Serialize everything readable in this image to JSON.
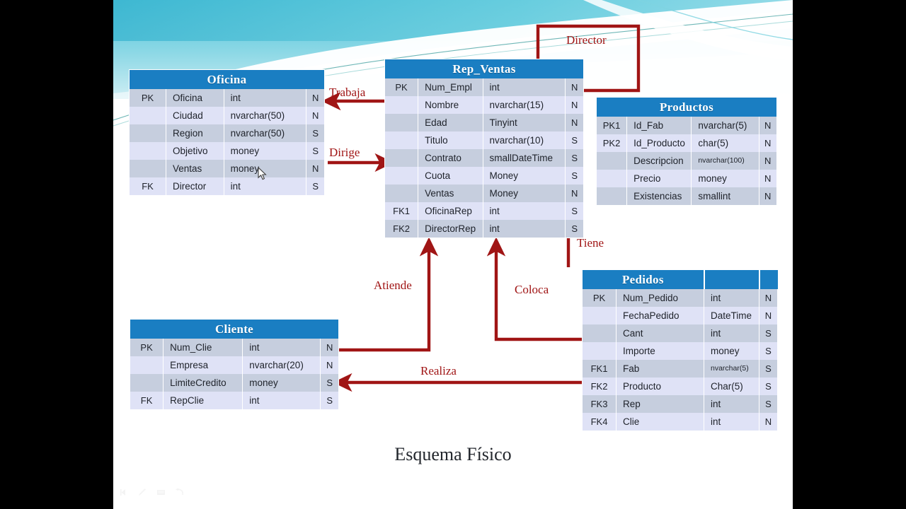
{
  "slide": {
    "caption": "Esquema Físico",
    "accent_header": "#1a7ec2",
    "arrow_color": "#a01515",
    "row_dark": "#c6cede",
    "row_light": "#dfe2f6"
  },
  "tables": [
    {
      "name": "Oficina",
      "rows": [
        {
          "key": "PK",
          "field": "Oficina",
          "type": "int",
          "null": "N"
        },
        {
          "key": "",
          "field": "Ciudad",
          "type": "nvarchar(50)",
          "null": "N"
        },
        {
          "key": "",
          "field": "Region",
          "type": "nvarchar(50)",
          "null": "S"
        },
        {
          "key": "",
          "field": "Objetivo",
          "type": "money",
          "null": "S"
        },
        {
          "key": "",
          "field": "Ventas",
          "type": "money",
          "null": "N"
        },
        {
          "key": "FK",
          "field": "Director",
          "type": "int",
          "null": "S"
        }
      ]
    },
    {
      "name": "Rep_Ventas",
      "rows": [
        {
          "key": "PK",
          "field": "Num_Empl",
          "type": "int",
          "null": "N"
        },
        {
          "key": "",
          "field": "Nombre",
          "type": "nvarchar(15)",
          "null": "N"
        },
        {
          "key": "",
          "field": "Edad",
          "type": "Tinyint",
          "null": "N"
        },
        {
          "key": "",
          "field": "Titulo",
          "type": "nvarchar(10)",
          "null": "S"
        },
        {
          "key": "",
          "field": "Contrato",
          "type": "smallDateTime",
          "null": "S"
        },
        {
          "key": "",
          "field": "Cuota",
          "type": "Money",
          "null": "S"
        },
        {
          "key": "",
          "field": "Ventas",
          "type": "Money",
          "null": "N"
        },
        {
          "key": "FK1",
          "field": "OficinaRep",
          "type": "int",
          "null": "S"
        },
        {
          "key": "FK2",
          "field": "DirectorRep",
          "type": "int",
          "null": "S"
        }
      ]
    },
    {
      "name": "Productos",
      "rows": [
        {
          "key": "PK1",
          "field": "Id_Fab",
          "type": "nvarchar(5)",
          "null": "N"
        },
        {
          "key": "PK2",
          "field": "Id_Producto",
          "type": "char(5)",
          "null": "N"
        },
        {
          "key": "",
          "field": "Descripcion",
          "type": "nvarchar(100)",
          "null": "N",
          "small": true
        },
        {
          "key": "",
          "field": "Precio",
          "type": "money",
          "null": "N"
        },
        {
          "key": "",
          "field": "Existencias",
          "type": "smallint",
          "null": "N"
        }
      ]
    },
    {
      "name": "Pedidos",
      "rows": [
        {
          "key": "PK",
          "field": "Num_Pedido",
          "type": "int",
          "null": "N"
        },
        {
          "key": "",
          "field": "FechaPedido",
          "type": "DateTime",
          "null": "N"
        },
        {
          "key": "",
          "field": "Cant",
          "type": "int",
          "null": "S"
        },
        {
          "key": "",
          "field": "Importe",
          "type": "money",
          "null": "S"
        },
        {
          "key": "FK1",
          "field": "Fab",
          "type": "nvarchar(5)",
          "null": "S",
          "small": true
        },
        {
          "key": "FK2",
          "field": "Producto",
          "type": "Char(5)",
          "null": "S"
        },
        {
          "key": "FK3",
          "field": "Rep",
          "type": "int",
          "null": "S"
        },
        {
          "key": "FK4",
          "field": "Clie",
          "type": "int",
          "null": "N"
        }
      ]
    },
    {
      "name": "Cliente",
      "rows": [
        {
          "key": "PK",
          "field": "Num_Clie",
          "type": "int",
          "null": "N"
        },
        {
          "key": "",
          "field": "Empresa",
          "type": "nvarchar(20)",
          "null": "N"
        },
        {
          "key": "",
          "field": "LimiteCredito",
          "type": "money",
          "null": "S"
        },
        {
          "key": "FK",
          "field": "RepClie",
          "type": "int",
          "null": "S"
        }
      ]
    }
  ],
  "relationships": [
    {
      "label": "Director"
    },
    {
      "label": "Trabaja"
    },
    {
      "label": "Dirige"
    },
    {
      "label": "Tiene"
    },
    {
      "label": "Atiende"
    },
    {
      "label": "Coloca"
    },
    {
      "label": "Realiza"
    }
  ],
  "presentation_controls": [
    "prev-slide-icon",
    "pen-icon",
    "menu-icon",
    "next-slide-icon"
  ]
}
